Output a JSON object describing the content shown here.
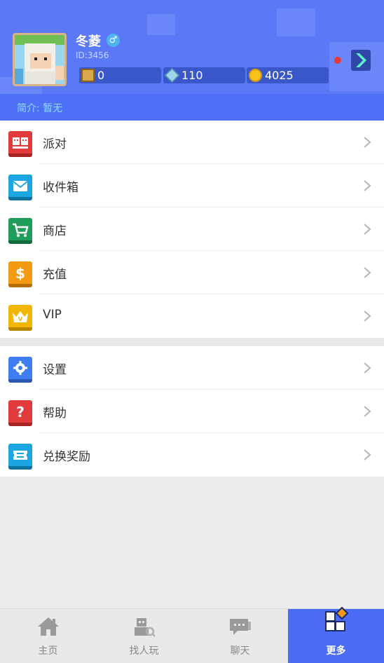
{
  "profile": {
    "username": "冬菱",
    "gender_symbol": "♂",
    "id_text": "ID:3456",
    "bio": "简介: 暂无",
    "currencies": [
      {
        "name": "box-icon",
        "value": "0"
      },
      {
        "name": "gem-icon",
        "value": "110"
      },
      {
        "name": "coin-icon",
        "value": "4025"
      }
    ]
  },
  "menu_primary": [
    {
      "label": "派对",
      "icon": "party-icon",
      "color": "#e23b3b"
    },
    {
      "label": "收件箱",
      "icon": "mail-icon",
      "color": "#1aa6e0"
    },
    {
      "label": "商店",
      "icon": "cart-icon",
      "color": "#1f9d5a"
    },
    {
      "label": "充值",
      "icon": "dollar-icon",
      "color": "#f39a12"
    },
    {
      "label": "VIP",
      "icon": "crown-icon",
      "color": "#f2b705"
    }
  ],
  "menu_secondary": [
    {
      "label": "设置",
      "icon": "gear-icon",
      "color": "#3f7ef2"
    },
    {
      "label": "帮助",
      "icon": "question-icon",
      "color": "#e23b3b"
    },
    {
      "label": "兑换奖励",
      "icon": "ticket-icon",
      "color": "#1aa6e0"
    }
  ],
  "bottom_nav": [
    {
      "label": "主页",
      "icon": "home-icon"
    },
    {
      "label": "找人玩",
      "icon": "find-friends-icon"
    },
    {
      "label": "聊天",
      "icon": "chat-icon"
    },
    {
      "label": "更多",
      "icon": "more-icon",
      "active": true
    }
  ],
  "colors": {
    "header": "#5b79f7",
    "active_tab": "#4a6cf6",
    "notification_dot": "#e53935"
  }
}
